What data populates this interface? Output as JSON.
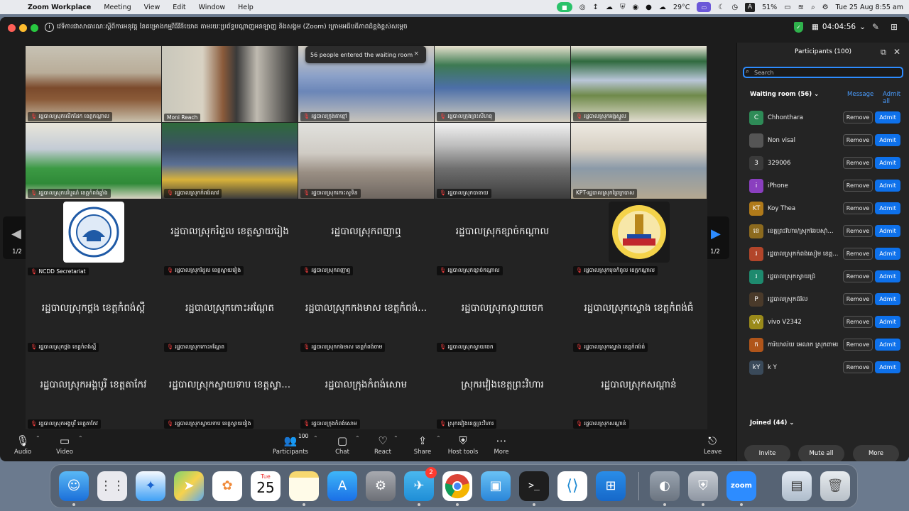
{
  "menubar": {
    "apple": "",
    "items": [
      "Zoom Workplace",
      "Meeting",
      "View",
      "Edit",
      "Window",
      "Help"
    ],
    "weather": "29°C",
    "battery": "51%",
    "datetime": "Tue 25 Aug  8:55 am",
    "input_source": "A"
  },
  "titlebar": {
    "meeting_title": "វេទិការជាសាធារណៈស្តីពីការអនុវត្ត នៃគម្រោងកម្មវិធីវិនិយោគ តាមរយៈប្រព័ន្ធបណ្តាញអនឡាញ និងសង្គម (Zoom) ក្រោមអធិបតីភាពដ៏ខ្ពង់ខ្ពស់សម្ដេច",
    "timer": "04:04:56"
  },
  "toast": {
    "text": "56 people entered the waiting room",
    "close": "×"
  },
  "pager": {
    "left": "1/2",
    "right": "1/2"
  },
  "video_tiles": [
    {
      "name": "រដ្ឋបាលស្រុកលើកដែក ខេត្តកណ្តាល",
      "muted": true
    },
    {
      "name": "Moni Reach",
      "muted": false
    },
    {
      "name": "រដ្ឋបាលក្រុងតាខ្មៅ",
      "muted": true
    },
    {
      "name": "រដ្ឋបាលក្រុងព្រះសីហនុ",
      "muted": true
    },
    {
      "name": "រដ្ឋបាលស្រុកអង្គស្នួល",
      "muted": true
    },
    {
      "name": "រដ្ឋបាលស្រុកបរិបូណ៌ ខេត្តកំពង់ឆ្នាំង",
      "muted": true
    },
    {
      "name": "រដ្ឋបាលស្រុកកំពង់លាវ",
      "muted": true
    },
    {
      "name": "រដ្ឋបាលស្រុកកោះសូទិន",
      "muted": true
    },
    {
      "name": "រដ្ឋបាលស្រុកបាធាយ",
      "muted": true
    },
    {
      "name": "KPT-រដ្ឋបាលស្រុកព្រៃក្របាស",
      "muted": false
    }
  ],
  "name_tiles": [
    {
      "big": "",
      "name": "NCDD Secretariat",
      "logo": "ncdd"
    },
    {
      "big": "រដ្ឋបាលស្រុករំដួល ខេត្តស្វាយរៀង",
      "name": "រដ្ឋបាលស្រុករំដួល ខេត្តស្វាយរៀង"
    },
    {
      "big": "រដ្ឋបាលស្រុកពញាឮ",
      "name": "រដ្ឋបាលស្រុកពញាឮ"
    },
    {
      "big": "រដ្ឋបាលស្រុកខ្សាច់កណ្តាល",
      "name": "រដ្ឋបាលស្រុកខ្សាច់កណ្តាល"
    },
    {
      "big": "",
      "name": "រដ្ឋបាលស្រុកមុខកំពូល ខេត្តកណ្តាល",
      "logo": "emblem"
    },
    {
      "big": "រដ្ឋបាលស្រុកថ្ពង ខេត្តកំពង់ស្ពឺ",
      "name": "រដ្ឋបាលស្រុកថ្ពង ខេត្តកំពង់ស្ពឺ"
    },
    {
      "big": "រដ្ឋបាលស្រុកកោះអណ្តែត",
      "name": "រដ្ឋបាលស្រុកកោះអណ្តែត"
    },
    {
      "big": "រដ្ឋបាលស្រុកកងមាស ខេត្តកំពង់...",
      "name": "រដ្ឋបាលស្រុកកងមាស ខេត្តកំពង់ចាម"
    },
    {
      "big": "រដ្ឋបាលស្រុកស្វាយចេក",
      "name": "រដ្ឋបាលស្រុកស្វាយចេក"
    },
    {
      "big": "រដ្ឋបាលស្រុកស្ទោង ខេត្តកំពង់ធំ",
      "name": "រដ្ឋបាលស្រុកស្ទោង ខេត្តកំពង់ធំ"
    },
    {
      "big": "រដ្ឋបាលស្រុកអង្គបូរី ខេត្តតាកែវ",
      "name": "រដ្ឋបាលស្រុកអង្គបូរី ខេត្តតាកែវ"
    },
    {
      "big": "រដ្ឋបាលស្រុកស្វាយទាប ខេត្តស្វា...",
      "name": "រដ្ឋបាលស្រុកស្វាយទាប ខេត្តស្វាយរៀង"
    },
    {
      "big": "រដ្ឋបាលក្រុងកំពង់សោម",
      "name": "រដ្ឋបាលក្រុងកំពង់សោម"
    },
    {
      "big": "ស្រុករវៀងខេត្តព្រះវិហារ",
      "name": "ស្រុករវៀងខេត្តព្រះវិហារ"
    },
    {
      "big": "រដ្ឋបាលស្រុកសណ្តាន់",
      "name": "រដ្ឋបាលស្រុកសណ្តាន់"
    }
  ],
  "toolbar": {
    "audio": "Audio",
    "video": "Video",
    "participants": "Participants",
    "participants_count": "100",
    "chat": "Chat",
    "react": "React",
    "share": "Share",
    "host_tools": "Host tools",
    "more": "More",
    "leave": "Leave"
  },
  "panel": {
    "title": "Participants (100)",
    "search_placeholder": "Search",
    "waiting_room": "Waiting room (56)",
    "message": "Message",
    "admit_all": "Admit all",
    "remove": "Remove",
    "admit": "Admit",
    "joined": "Joined (44)",
    "invite": "Invite",
    "mute_all": "Mute all",
    "more": "More",
    "waiting": [
      {
        "initial": "C",
        "name": "Chhonthara",
        "color": "#2e8b57"
      },
      {
        "initial": "",
        "name": "Non visal",
        "color": "#555555"
      },
      {
        "initial": "3",
        "name": "329006",
        "color": "#3a3a3a"
      },
      {
        "initial": "i",
        "name": "iPhone",
        "color": "#8a3fbf"
      },
      {
        "initial": "KT",
        "name": "Koy Thea",
        "color": "#b07a1a"
      },
      {
        "initial": "ខេ",
        "name": "ខេត្តព្រះវិហារ/ស្រុកឆែបស៊ាំ...",
        "color": "#8c6a1e"
      },
      {
        "initial": "រ",
        "name": "រដ្ឋបាលស្រុកកំពង់សៀម ខេត្ត...",
        "color": "#b2452a"
      },
      {
        "initial": "រ",
        "name": "រដ្ឋបាលស្រុកស្វាយជ្រំ",
        "color": "#1e8a6e"
      },
      {
        "initial": "P",
        "name": "រដ្ឋបាលស្រុកដំរិល",
        "color": "#4a3a2a"
      },
      {
        "initial": "vV",
        "name": "vivo V2342",
        "color": "#9a8a1a"
      },
      {
        "initial": "ក",
        "name": "ការិយាល័យ អេណក ស្រុកពាមរក៏",
        "color": "#b0551a"
      },
      {
        "initial": "kY",
        "name": "k Y",
        "color": "#3a4a5a"
      }
    ]
  },
  "dock": {
    "calendar_month": "Tue",
    "calendar_day": "25",
    "telegram_badge": "2",
    "zoom_label": "zoom",
    "apps": [
      "finder",
      "launchpad",
      "safari",
      "maps",
      "photos",
      "calendar",
      "notes",
      "app-store",
      "system-settings",
      "telegram",
      "chrome",
      "preview",
      "terminal",
      "vscode",
      "windows-app",
      "tableplus",
      "vpn",
      "zoom",
      "downloads",
      "trash"
    ]
  }
}
